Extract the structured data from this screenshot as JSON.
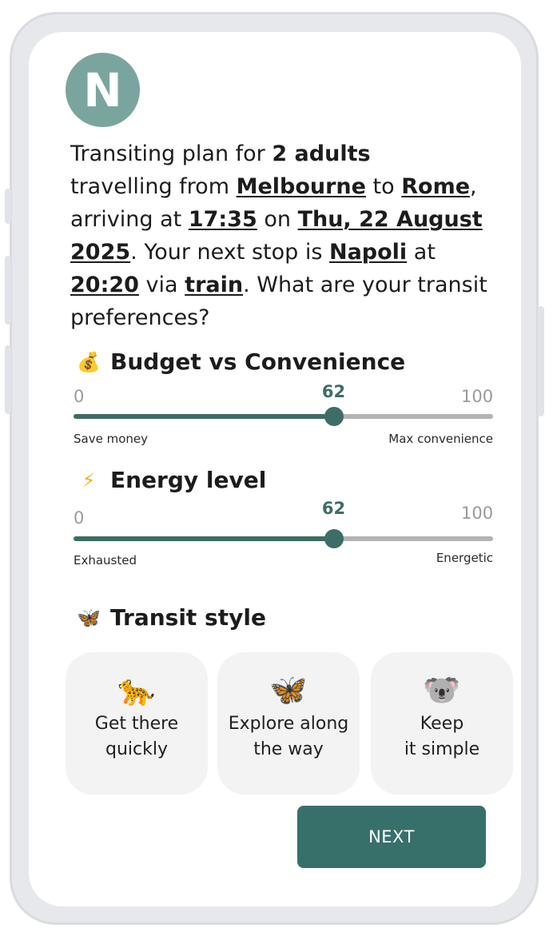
{
  "profile": {
    "initial": "N"
  },
  "intro": {
    "p1": "Transiting plan for ",
    "adults": "2 adults",
    "p2": "travelling from ",
    "origin": "Melbourne",
    "p3": " to ",
    "destination": "Rome",
    "p4": ", arriving at ",
    "arrival_time": "17:35",
    "p5": " on ",
    "arrival_date": "Thu, 22 August 2025",
    "p6": ". Your next stop is ",
    "next_stop": "Napoli",
    "p7": " at ",
    "next_time": "20:20",
    "p8": " via ",
    "mode": "train",
    "p9": ". What are your transit preferences?"
  },
  "budget": {
    "icon": "money-bag-icon",
    "emoji": "💰",
    "title": "Budget vs Convenience",
    "min": "0",
    "max": "100",
    "value": "62",
    "value_num": 62,
    "left_label": "Save money",
    "right_label": "Max convenience"
  },
  "energy": {
    "icon": "lightning-icon",
    "emoji": "⚡",
    "title": "Energy level",
    "min": "0",
    "max": "100",
    "value": "62",
    "value_num": 62,
    "left_label": "Exhausted",
    "right_label": "Energetic"
  },
  "transit_style": {
    "icon": "butterfly-icon",
    "emoji": "🦋",
    "title": "Transit style",
    "options": [
      {
        "emoji": "🐆",
        "icon": "leopard-icon",
        "label": "Get there\nquickly"
      },
      {
        "emoji": "🦋",
        "icon": "butterfly-icon",
        "label": "Explore along\nthe way"
      },
      {
        "emoji": "🐨",
        "icon": "koala-icon",
        "label": "Keep\nit simple"
      }
    ]
  },
  "next_button": "NEXT",
  "colors": {
    "accent": "#37706a",
    "avatar": "#7aa59f",
    "track": "#b3b3b3",
    "card": "#f3f3f4"
  }
}
